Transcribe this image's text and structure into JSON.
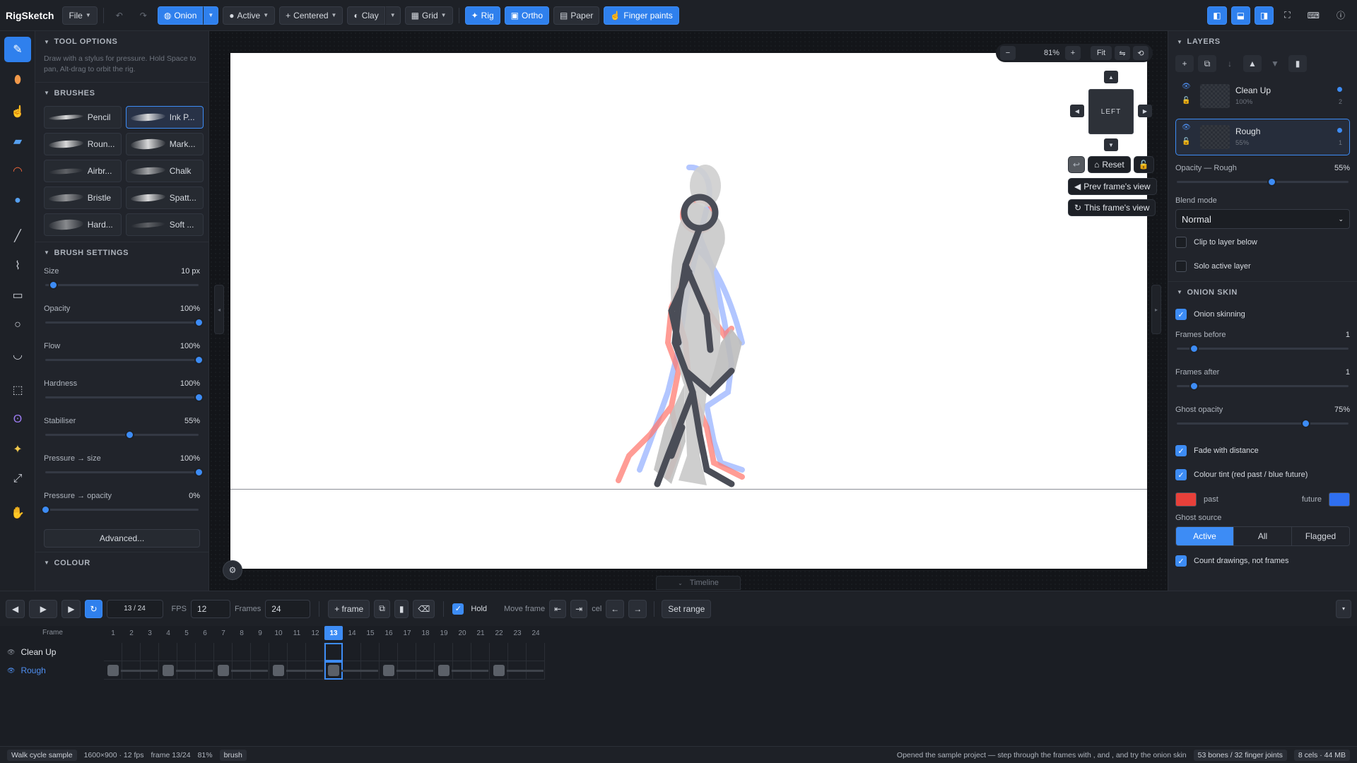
{
  "app": {
    "name": "RigSketch"
  },
  "topbar": {
    "file": "File",
    "onion": "Onion",
    "active": "Active",
    "centered": "Centered",
    "clay": "Clay",
    "grid": "Grid",
    "rig": "Rig",
    "ortho": "Ortho",
    "paper": "Paper",
    "finger_paints": "Finger paints"
  },
  "tool_options": {
    "title": "TOOL OPTIONS",
    "hint": "Draw with a stylus for pressure. Hold Space to pan, Alt-drag to orbit the rig."
  },
  "brushes": {
    "title": "BRUSHES",
    "items": [
      "Pencil",
      "Ink P...",
      "Roun...",
      "Mark...",
      "Airbr...",
      "Chalk",
      "Bristle",
      "Spatt...",
      "Hard...",
      "Soft ..."
    ]
  },
  "brush_settings": {
    "title": "BRUSH SETTINGS",
    "sliders": [
      {
        "name": "Size",
        "value": "10 px",
        "pos": 0.05
      },
      {
        "name": "Opacity",
        "value": "100%",
        "pos": 1.0
      },
      {
        "name": "Flow",
        "value": "100%",
        "pos": 1.0
      },
      {
        "name": "Hardness",
        "value": "100%",
        "pos": 1.0
      },
      {
        "name": "Stabiliser",
        "value": "55%",
        "pos": 0.55
      },
      {
        "name": "Pressure → size",
        "value": "100%",
        "pos": 1.0
      },
      {
        "name": "Pressure → opacity",
        "value": "0%",
        "pos": 0.0
      }
    ],
    "advanced": "Advanced..."
  },
  "colour": {
    "title": "COLOUR"
  },
  "viewport": {
    "zoom": "81%",
    "fit": "Fit",
    "cube_face": "LEFT",
    "reset": "Reset",
    "prev_view": "Prev frame's view",
    "this_view": "This frame's view",
    "timeline_tab": "Timeline"
  },
  "layers": {
    "title": "LAYERS",
    "items": [
      {
        "name": "Clean Up",
        "opacity": "100%",
        "index": "2"
      },
      {
        "name": "Rough",
        "opacity": "55%",
        "index": "1"
      }
    ],
    "opacity_label": "Opacity — Rough",
    "opacity_value": "55%",
    "opacity_pos": 0.55,
    "blend_label": "Blend mode",
    "blend_value": "Normal",
    "clip": "Clip to layer below",
    "solo": "Solo active layer"
  },
  "onion": {
    "title": "ONION SKIN",
    "enabled": "Onion skinning",
    "frames_before_label": "Frames before",
    "frames_before": "1",
    "frames_before_pos": 0.1,
    "frames_after_label": "Frames after",
    "frames_after": "1",
    "frames_after_pos": 0.1,
    "ghost_opacity_label": "Ghost opacity",
    "ghost_opacity": "75%",
    "ghost_opacity_pos": 0.75,
    "fade": "Fade with distance",
    "tint": "Colour tint (red past / blue future)",
    "past": "past",
    "future": "future",
    "past_color": "#e8403a",
    "future_color": "#2f6ff0",
    "ghost_source_label": "Ghost source",
    "ghost_sources": [
      "Active",
      "All",
      "Flagged"
    ],
    "count": "Count drawings, not frames"
  },
  "timeline": {
    "frame_counter": "13 / 24",
    "fps_label": "FPS",
    "fps": "12",
    "frames_label": "Frames",
    "frames": "24",
    "add_frame": "+ frame",
    "hold": "Hold",
    "move_frame": "Move frame",
    "cel": "cel",
    "set_range": "Set range",
    "frame_col": "Frame",
    "current_frame": 13,
    "total_frames": 24,
    "rows": [
      {
        "name": "Clean Up",
        "keys": []
      },
      {
        "name": "Rough",
        "keys": [
          1,
          4,
          7,
          10,
          13,
          16,
          19,
          22
        ]
      }
    ]
  },
  "status": {
    "sample": "Walk cycle sample",
    "doc": "1600×900 · 12 fps",
    "frame": "frame 13/24",
    "zoom": "81%",
    "tool": "brush",
    "message": "Opened the sample project — step through the frames with , and , and try the onion skin",
    "rig": "53 bones / 32 finger joints",
    "memory": "8 cels · 44 MB"
  }
}
